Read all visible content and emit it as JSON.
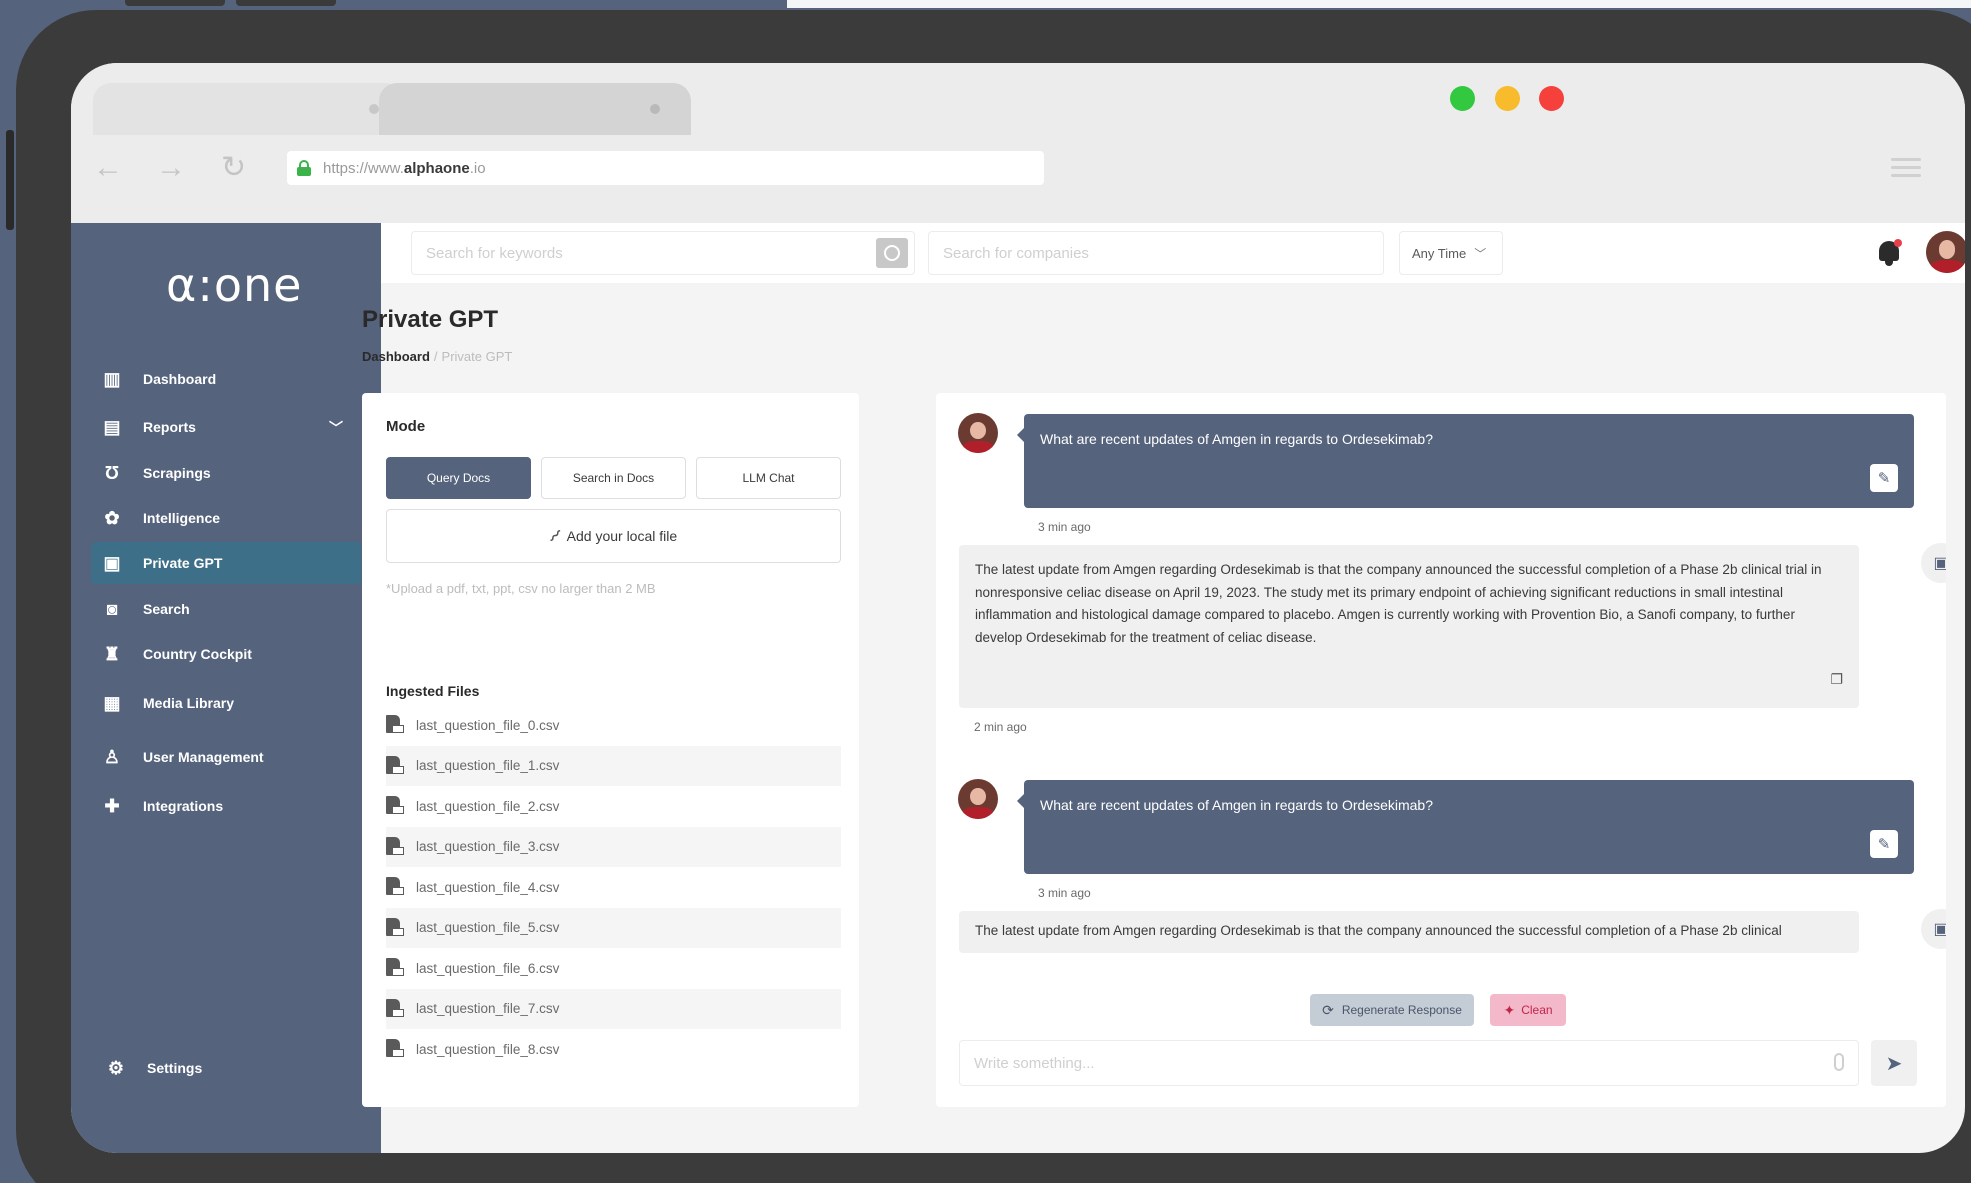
{
  "browser": {
    "url_prefix": "https://www.",
    "url_domain": "alphaone",
    "url_suffix": ".io",
    "window_buttons": {
      "green": "#32c840",
      "yellow": "#f7bb2b",
      "red": "#f5403b"
    }
  },
  "sidebar": {
    "logo": "α:one",
    "items": [
      {
        "label": "Dashboard",
        "icon": "dashboard-icon",
        "glyph": "▥"
      },
      {
        "label": "Reports",
        "icon": "reports-icon",
        "glyph": "▤"
      },
      {
        "label": "Scrapings",
        "icon": "magnet-icon",
        "glyph": "Ʊ"
      },
      {
        "label": "Intelligence",
        "icon": "brain-icon",
        "glyph": "✿"
      },
      {
        "label": "Private GPT",
        "icon": "chat-bot-icon",
        "glyph": "▣"
      },
      {
        "label": "Search",
        "icon": "search-folder-icon",
        "glyph": "◙"
      },
      {
        "label": "Country Cockpit",
        "icon": "binoculars-icon",
        "glyph": "♜"
      },
      {
        "label": "Media Library",
        "icon": "media-icon",
        "glyph": "▦"
      },
      {
        "label": "User Management",
        "icon": "user-gear-icon",
        "glyph": "♙"
      },
      {
        "label": "Integrations",
        "icon": "puzzle-icon",
        "glyph": "✚"
      }
    ],
    "settings_label": "Settings",
    "colors": {
      "bg": "#55637d",
      "active": "#3e6f88"
    }
  },
  "topbar": {
    "keyword_placeholder": "Search for keywords",
    "company_placeholder": "Search for companies",
    "time_filter": "Any Time"
  },
  "page": {
    "title": "Private GPT",
    "breadcrumb_home": "Dashboard",
    "breadcrumb_sep": "/",
    "breadcrumb_current": "Private GPT"
  },
  "mode_panel": {
    "title": "Mode",
    "modes": [
      "Query Docs",
      "Search in Docs",
      "LLM Chat"
    ],
    "active_mode": "Query Docs",
    "add_file_label": "Add your local file",
    "upload_note": "*Upload a pdf, txt, ppt, csv no larger than 2 MB",
    "ingested_title": "Ingested Files",
    "files": [
      "last_question_file_0.csv",
      "last_question_file_1.csv",
      "last_question_file_2.csv",
      "last_question_file_3.csv",
      "last_question_file_4.csv",
      "last_question_file_5.csv",
      "last_question_file_6.csv",
      "last_question_file_7.csv",
      "last_question_file_8.csv"
    ]
  },
  "chat": {
    "messages": [
      {
        "role": "user",
        "text": "What are recent updates of Amgen in regards to Ordesekimab?",
        "time": "3 min ago"
      },
      {
        "role": "assistant",
        "text": "The latest update from Amgen regarding Ordesekimab is that the company announced the successful completion of a Phase 2b clinical trial in nonresponsive celiac disease on April 19, 2023. The study met its primary endpoint of achieving significant reductions in small intestinal inflammation and histological damage compared to placebo. Amgen is currently working with Provention Bio, a Sanofi company, to further develop Ordesekimab for the treatment of celiac disease.",
        "time": "2 min ago"
      },
      {
        "role": "user",
        "text": "What are recent updates of Amgen in regards to Ordesekimab?",
        "time": "3 min ago"
      },
      {
        "role": "assistant",
        "text": "The latest update from Amgen regarding Ordesekimab is that the company announced the successful completion of a Phase 2b clinical"
      }
    ],
    "regenerate_label": "Regenerate Response",
    "clean_label": "Clean",
    "input_placeholder": "Write something..."
  }
}
